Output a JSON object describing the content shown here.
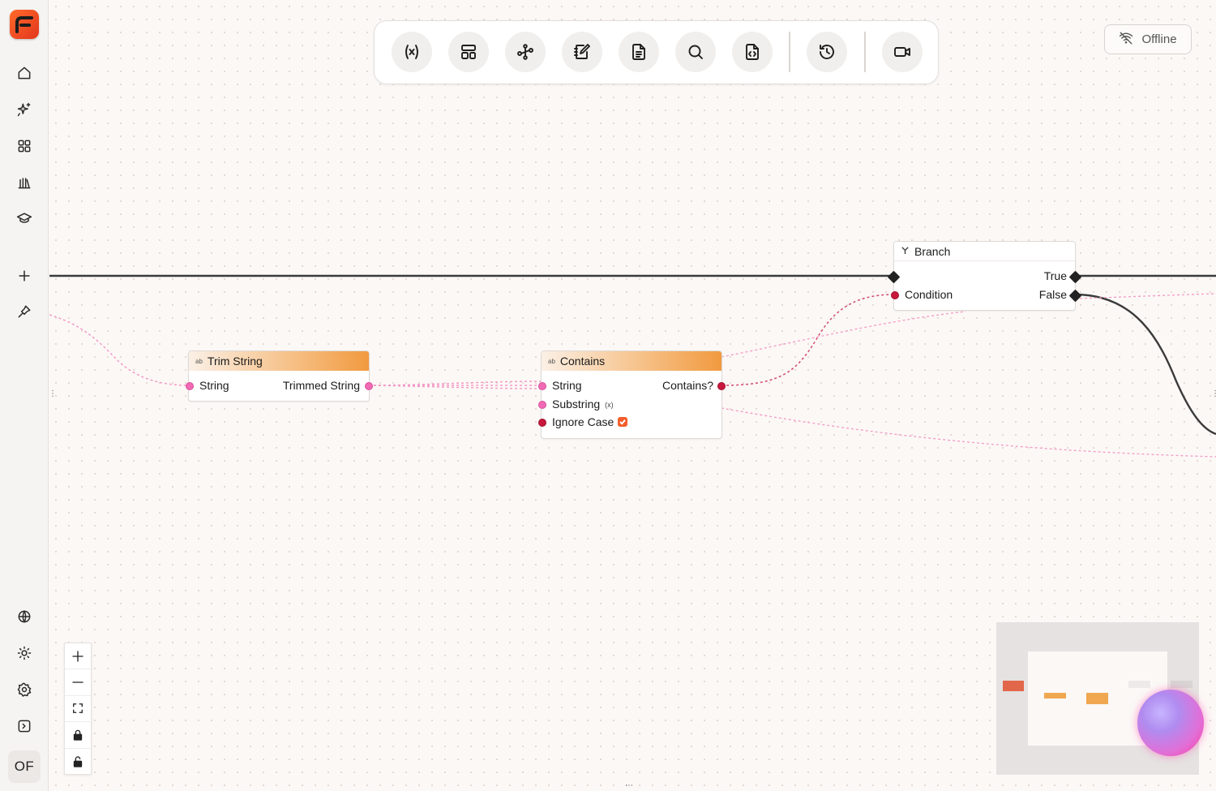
{
  "sidebar": {
    "logo_icon": "flow-logo-icon",
    "top_items": [
      "home-icon",
      "sparkles-icon",
      "grid-icon",
      "library-icon",
      "graduation-cap-icon"
    ],
    "mid_items": [
      "plus-icon",
      "pin-icon"
    ],
    "bottom_items": [
      "globe-icon",
      "sun-icon",
      "gear-icon",
      "panel-toggle-icon"
    ],
    "avatar": "OF"
  },
  "toolbar": {
    "tools": [
      "variable-icon",
      "layout-icon",
      "workflow-icon",
      "notebook-pen-icon",
      "file-text-icon",
      "search-icon",
      "file-code-icon"
    ],
    "history": "history-icon",
    "record": "video-icon"
  },
  "status": {
    "label": "Offline",
    "icon": "wifi-off-icon"
  },
  "nodes": {
    "trim": {
      "title": "Trim String",
      "input": "String",
      "output": "Trimmed String"
    },
    "contains": {
      "title": "Contains",
      "in1": "String",
      "in2": "Substring",
      "in3": "Ignore Case",
      "output": "Contains?",
      "ignore_case": true
    },
    "branch": {
      "title": "Branch",
      "input": "Condition",
      "out_true": "True",
      "out_false": "False"
    }
  },
  "colors": {
    "accent": "#f45d2c",
    "string_pin": "#f06ab4",
    "bool_pin": "#c8183c",
    "header_gradient_end": "#f19a3f"
  },
  "zoom_controls": [
    "plus-icon",
    "minus-icon",
    "fit-view-icon",
    "lock-icon",
    "unlock-icon"
  ]
}
